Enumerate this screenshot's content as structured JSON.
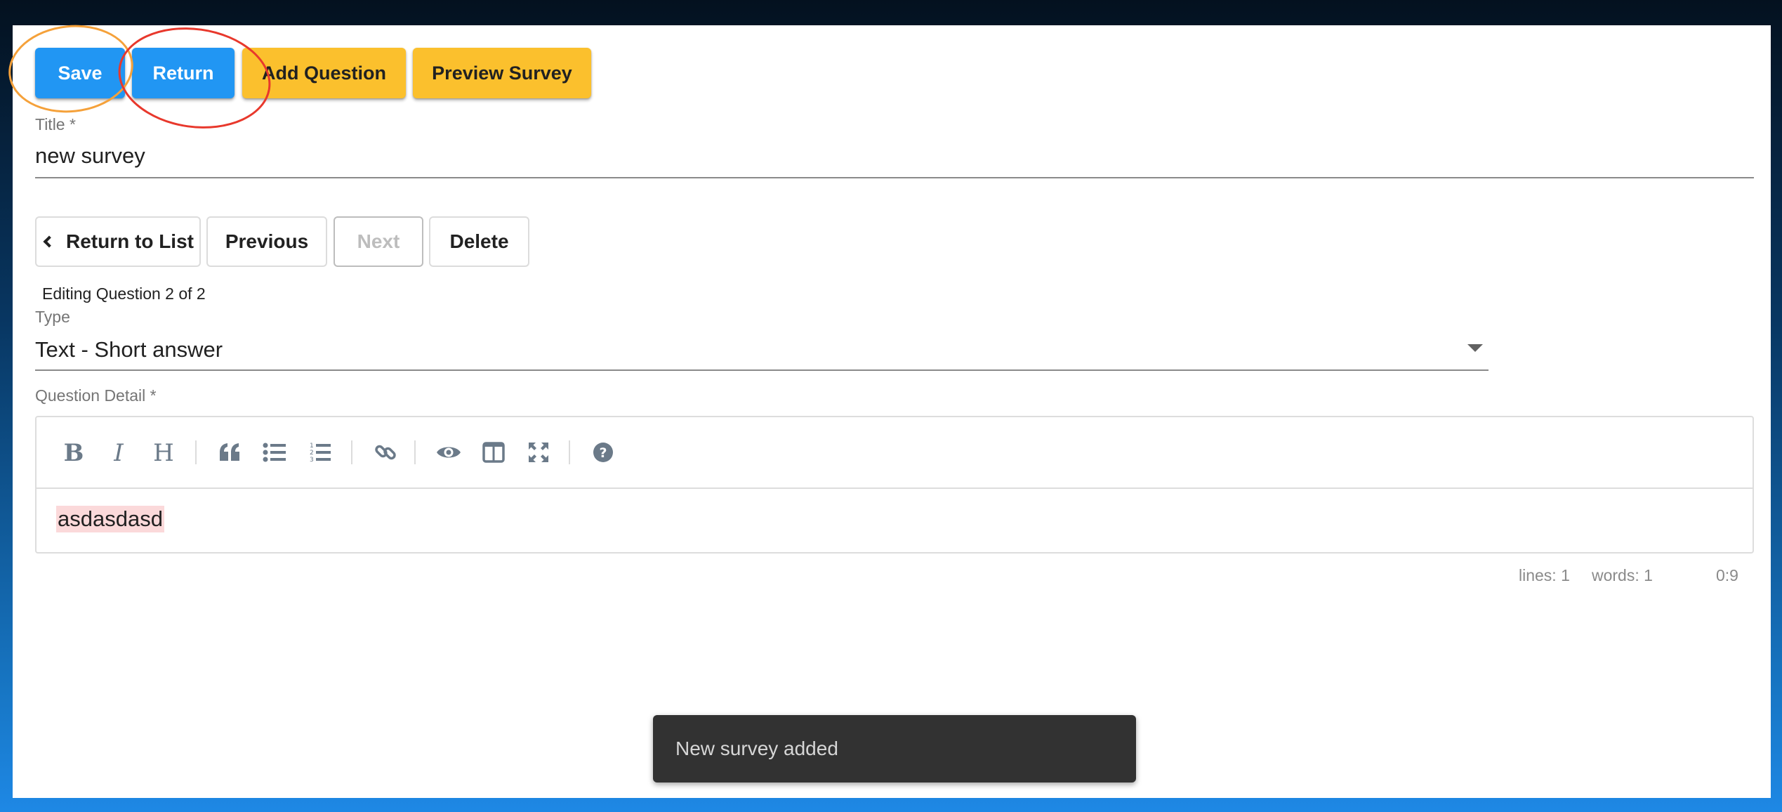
{
  "toolbar_top": {
    "save_label": "Save",
    "return_label": "Return",
    "add_question_label": "Add Question",
    "preview_survey_label": "Preview Survey"
  },
  "title_field": {
    "label": "Title *",
    "value": "new survey"
  },
  "nav": {
    "return_to_list_label": "Return to List",
    "previous_label": "Previous",
    "next_label": "Next",
    "delete_label": "Delete"
  },
  "editing_status": "Editing Question 2 of 2",
  "type_field": {
    "label": "Type",
    "value": "Text - Short answer"
  },
  "question_detail": {
    "label": "Question Detail *",
    "content": "asdasdasd",
    "toolbar_icons": [
      "bold-icon",
      "italic-icon",
      "heading-icon",
      "quote-icon",
      "unordered-list-icon",
      "ordered-list-icon",
      "link-icon",
      "preview-icon",
      "side-by-side-icon",
      "fullscreen-icon",
      "help-icon"
    ]
  },
  "editor_status": {
    "lines": "lines: 1",
    "words": "words: 1",
    "cursor": "0:9"
  },
  "snackbar": {
    "message": "New survey added"
  },
  "colors": {
    "primary_blue": "#2196f3",
    "amber": "#fbc02d",
    "annotation_orange": "#f5a13a",
    "annotation_red": "#e8382c",
    "snackbar_bg": "#323232",
    "highlight": "#fbd9da"
  }
}
